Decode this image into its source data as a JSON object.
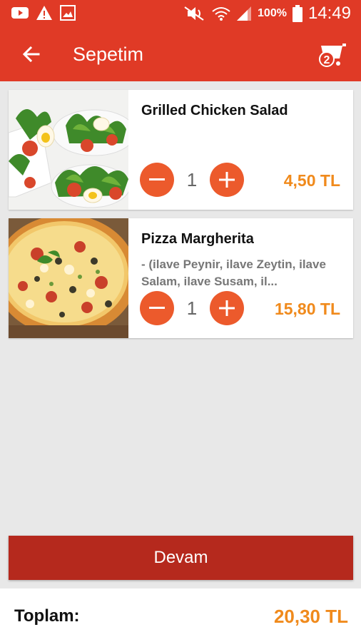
{
  "status_bar": {
    "battery_percent": "100%",
    "time": "14:49",
    "icons": [
      "youtube-icon",
      "warning-icon",
      "image-icon",
      "mute-icon",
      "wifi-icon",
      "signal-icon",
      "battery-icon"
    ]
  },
  "app_bar": {
    "title": "Sepetim",
    "back_icon": "arrow-left-icon",
    "cart_icon": "cart-icon",
    "cart_badge": "2"
  },
  "items": [
    {
      "name": "Grilled Chicken Salad",
      "description": "",
      "quantity": "1",
      "price": "4,50 TL",
      "image": "salad-photo"
    },
    {
      "name": "Pizza Margherita",
      "description": " - (ilave Peynir, ilave Zeytin, ilave Salam, ilave Susam, il...",
      "quantity": "1",
      "price": "15,80 TL",
      "image": "pizza-photo"
    }
  ],
  "continue_label": "Devam",
  "total": {
    "label": "Toplam:",
    "value": "20,30 TL"
  },
  "colors": {
    "primary": "#e03a26",
    "button_dark": "#b5291d",
    "accent_orange": "#ec5a2c",
    "price_orange": "#f08a1c",
    "background": "#e8e8e8"
  }
}
